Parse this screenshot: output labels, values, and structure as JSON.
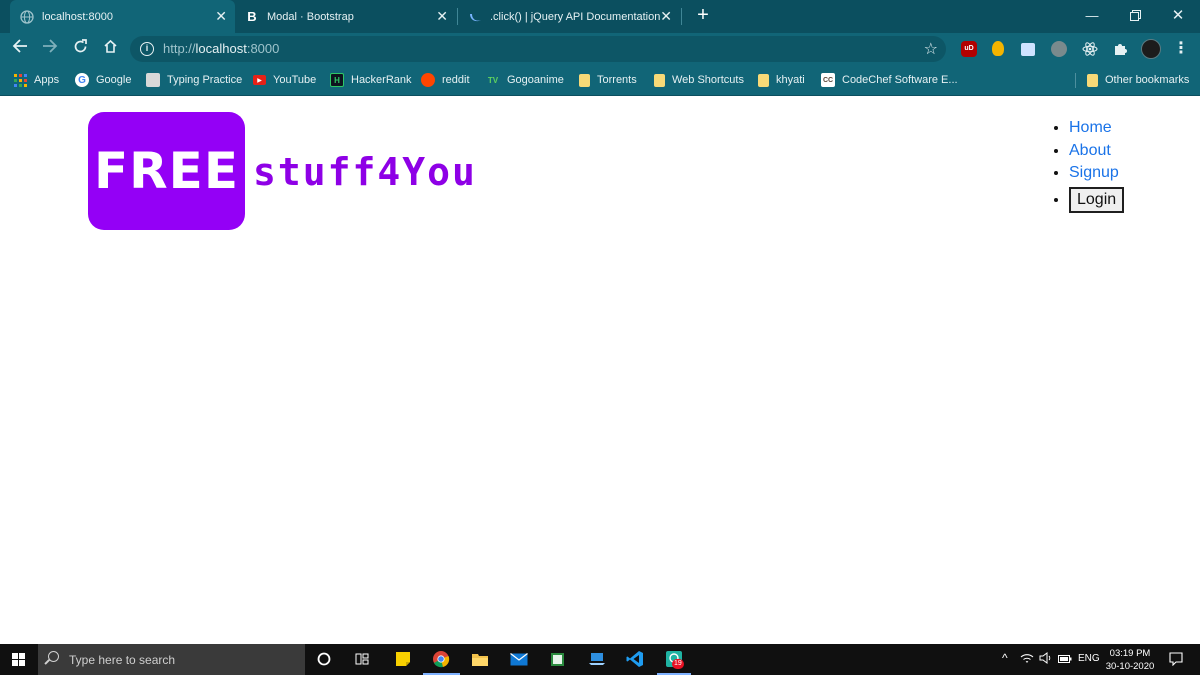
{
  "browser": {
    "tabs": [
      {
        "title": "localhost:8000",
        "favicon": "globe-icon",
        "active": true
      },
      {
        "title": "Modal · Bootstrap",
        "favicon": "bootstrap-icon",
        "badge": "B",
        "active": false
      },
      {
        "title": ".click() | jQuery API Documentation",
        "favicon": "jquery-icon",
        "active": false
      }
    ],
    "address_bar": {
      "scheme": "http://",
      "host": "localhost",
      "port": ":8000"
    },
    "bookmarks": [
      {
        "label": "Apps",
        "icon": "apps-grid-icon"
      },
      {
        "label": "Google",
        "icon": "google-icon",
        "badge": "G"
      },
      {
        "label": "Typing Practice",
        "icon": "typing-icon"
      },
      {
        "label": "YouTube",
        "icon": "youtube-icon",
        "badge": "▶"
      },
      {
        "label": "HackerRank",
        "icon": "hackerrank-icon",
        "badge": "H"
      },
      {
        "label": "reddit",
        "icon": "reddit-icon"
      },
      {
        "label": "Gogoanime",
        "icon": "gogoanime-icon",
        "badge": "TV"
      },
      {
        "label": "Torrents",
        "icon": "folder-icon"
      },
      {
        "label": "Web Shortcuts",
        "icon": "folder-icon"
      },
      {
        "label": "khyati",
        "icon": "folder-icon"
      },
      {
        "label": "CodeChef Software E...",
        "icon": "codechef-icon",
        "badge": "CC"
      },
      {
        "label": "Other bookmarks",
        "icon": "folder-icon"
      }
    ],
    "extensions": {
      "ublock_badge": "uD"
    }
  },
  "page": {
    "logo": {
      "badge_text": "FREE",
      "wordmark": "stuff4You"
    },
    "nav": {
      "home": "Home",
      "about": "About",
      "signup": "Signup",
      "login": "Login"
    }
  },
  "taskbar": {
    "search_placeholder": "Type here to search",
    "language": "ENG",
    "time": "03:19 PM",
    "date": "30-10-2020",
    "notification_badge": "19"
  },
  "colors": {
    "chrome_dark": "#0b4f5f",
    "chrome_toolbar": "#116577",
    "logo_purple": "#9400f6",
    "link_blue": "#1a73e8"
  }
}
